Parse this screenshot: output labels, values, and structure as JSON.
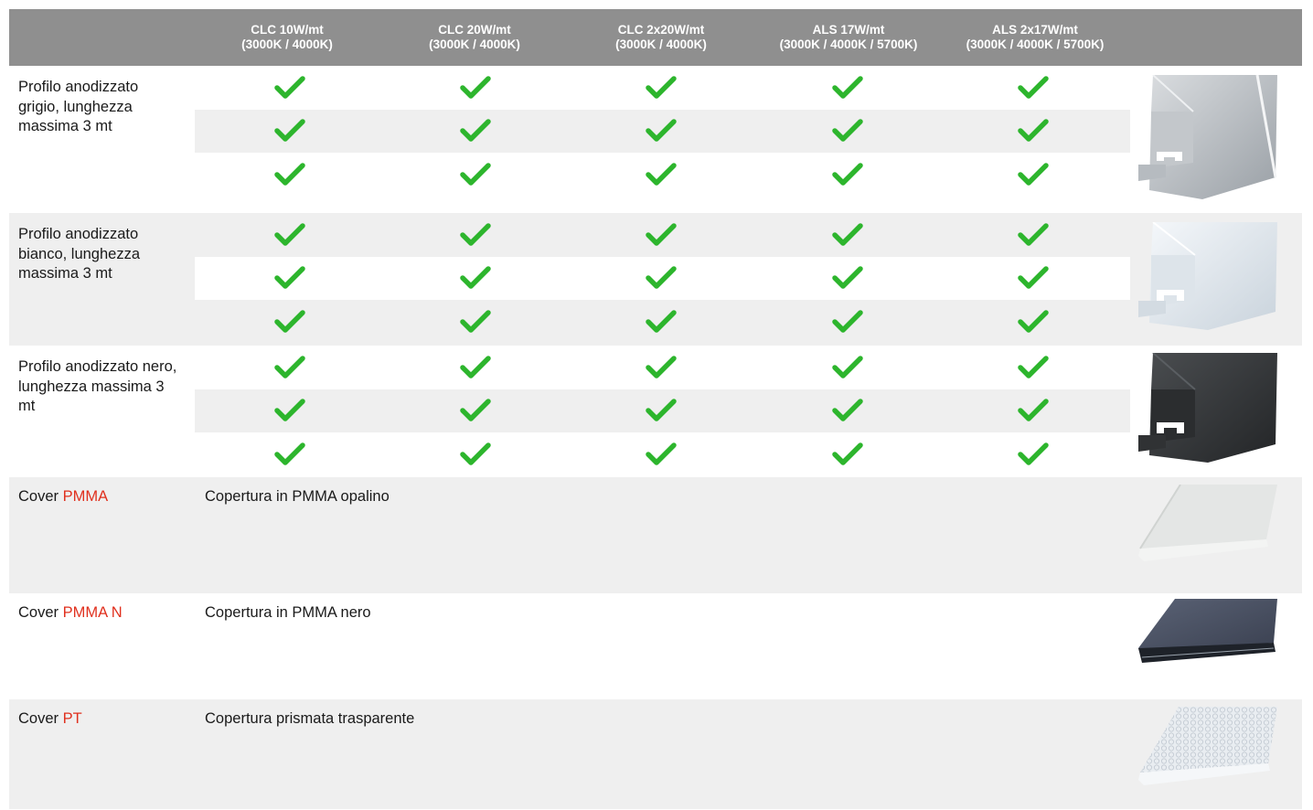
{
  "header": {
    "columns": [
      {
        "line1": "CLC 10W/mt",
        "line2": "(3000K / 4000K)"
      },
      {
        "line1": "CLC 20W/mt",
        "line2": "(3000K / 4000K)"
      },
      {
        "line1": "CLC 2x20W/mt",
        "line2": "(3000K / 4000K)"
      },
      {
        "line1": "ALS 17W/mt",
        "line2": "(3000K / 4000K / 5700K)"
      },
      {
        "line1": "ALS 2x17W/mt",
        "line2": "(3000K / 4000K / 5700K)"
      }
    ]
  },
  "profiles": [
    {
      "label": "Profilo anodizzato grigio, lunghezza massima 3 mt",
      "image": "grey-aluminium-profile",
      "checks": [
        [
          true,
          true,
          true,
          true,
          true
        ],
        [
          true,
          true,
          true,
          true,
          true
        ],
        [
          true,
          true,
          true,
          true,
          true
        ]
      ]
    },
    {
      "label": "Profilo anodizzato bianco, lunghezza massima 3 mt",
      "image": "white-aluminium-profile",
      "checks": [
        [
          true,
          true,
          true,
          true,
          true
        ],
        [
          true,
          true,
          true,
          true,
          true
        ],
        [
          true,
          true,
          true,
          true,
          true
        ]
      ]
    },
    {
      "label": "Profilo anodizzato nero, lunghezza massima 3 mt",
      "image": "black-aluminium-profile",
      "checks": [
        [
          true,
          true,
          true,
          true,
          true
        ],
        [
          true,
          true,
          true,
          true,
          true
        ],
        [
          true,
          true,
          true,
          true,
          true
        ]
      ]
    }
  ],
  "covers": [
    {
      "prefix": "Cover ",
      "code": "PMMA",
      "description": "Copertura in PMMA opalino",
      "image": "opal-cover"
    },
    {
      "prefix": "Cover ",
      "code": "PMMA N",
      "description": "Copertura in PMMA nero",
      "image": "black-cover"
    },
    {
      "prefix": "Cover ",
      "code": "PT",
      "description": "Copertura prismata trasparente",
      "image": "prismatic-cover"
    }
  ],
  "colors": {
    "header_bg": "#8f8f8f",
    "row_grey": "#efefef",
    "check_green": "#2db52d",
    "code_red": "#e0301e"
  },
  "icons": {
    "check": "check-icon"
  }
}
